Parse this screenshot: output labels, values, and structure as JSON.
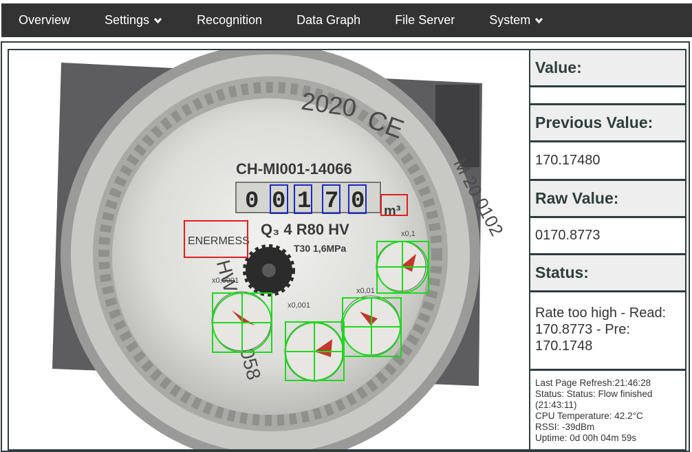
{
  "nav": {
    "items": [
      {
        "label": "Overview",
        "dropdown": false
      },
      {
        "label": "Settings",
        "dropdown": true
      },
      {
        "label": "Recognition",
        "dropdown": false
      },
      {
        "label": "Data Graph",
        "dropdown": false
      },
      {
        "label": "File Server",
        "dropdown": false
      },
      {
        "label": "System",
        "dropdown": true
      }
    ]
  },
  "colors": {
    "navbar": "#333333",
    "border": "#2f3d3d",
    "header_bg": "#eeeeee",
    "digit_roi": "#1a28c8",
    "alignment_roi": "#e01e1e",
    "analog_roi": "#1ed81e"
  },
  "meter_image": {
    "year": "2020",
    "ce_mark": "CE",
    "model": "CH-MI001-14066",
    "counter_digits": [
      "0",
      "0",
      "1",
      "7",
      "0"
    ],
    "unit": "m³",
    "brand": "ENERMESS",
    "spec_line": "Q₃ 4 R80 HV",
    "pressure": "T30 1,6MPa",
    "side_right": "M 20 0102",
    "side_left": "HW 20202058",
    "dial_labels": [
      "x0,1",
      "x0,01",
      "x0,001",
      "x0,0001"
    ]
  },
  "panel": {
    "value_label": "Value:",
    "value": "",
    "previous_label": "Previous Value:",
    "previous": "170.17480",
    "raw_label": "Raw Value:",
    "raw": "0170.8773",
    "status_label": "Status:",
    "status": "Rate too high - Read: 170.8773 - Pre: 170.1748",
    "info": {
      "refresh": "Last Page Refresh:21:46:28",
      "status_line1": "Status: Status: Flow finished",
      "status_line2": "(21:43:11)",
      "cpu": "CPU Temperature: 42.2°C",
      "rssi": "RSSI: -39dBm",
      "uptime": "Uptime: 0d 00h 04m 59s"
    }
  }
}
